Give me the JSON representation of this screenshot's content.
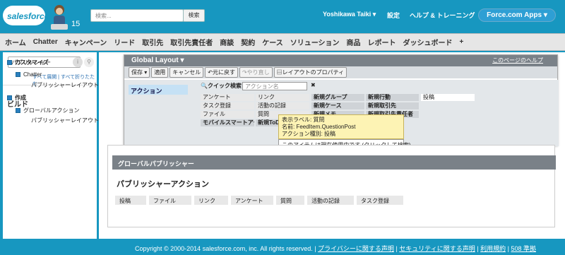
{
  "header": {
    "logo_text": "salesforce",
    "logo_number": "15",
    "search_placeholder": "検索...",
    "search_button": "検索",
    "user_name": "Yoshikawa Taiki ▾",
    "setup": "設定",
    "help": "ヘルプ & トレーニング",
    "apps": "Force.com Apps ▾"
  },
  "nav": {
    "tabs": [
      "ホーム",
      "Chatter",
      "キャンペーン",
      "リード",
      "取引先",
      "取引先責任者",
      "商談",
      "契約",
      "ケース",
      "ソリューション",
      "商品",
      "レポート",
      "ダッシュボード",
      "+"
    ]
  },
  "sidebar": {
    "search_value": "パブリッシャー",
    "expand_collapse": "すべて展開 | すべて折りたたむ",
    "section": "ビルド",
    "tree": [
      {
        "label": "カスタマイズ",
        "level": 0
      },
      {
        "label": "Chatter",
        "level": 1
      },
      {
        "label": "パブリッシャーレイアウト",
        "level": 2
      },
      {
        "label": "作成",
        "level": 0
      },
      {
        "label": "グローバルアクション",
        "level": 1
      },
      {
        "label": "パブリッシャーレイアウト",
        "level": 2
      }
    ]
  },
  "layout_editor": {
    "title": "Global Layout ▾",
    "help_link": "このページのヘルプ",
    "toolbar": {
      "save": "保存 ▾",
      "apply": "適用",
      "cancel": "キャンセル",
      "undo": "元に戻す",
      "redo": "やり直し",
      "properties": "レイアウトのプロパティ"
    },
    "left_item": "アクション",
    "quick_search": "クイック検索",
    "quick_search_placeholder": "アクション名",
    "grid": [
      [
        "アンケート",
        "リンク",
        "新規グループ",
        "新規行動",
        "投稿"
      ],
      [
        "タスク登録",
        "活動の記録",
        "新規ケース",
        "新規取引先",
        ""
      ],
      [
        "ファイル",
        "質問",
        "新規メモ",
        "新規取引先責任者",
        ""
      ],
      [
        "モバイルスマートアク",
        "新規ToDo",
        "",
        "",
        ""
      ]
    ],
    "tooltip": {
      "label": "表示ラベル: 質問",
      "name": "名前: FeedItem.QuestionPost",
      "type": "アクション種別: 投稿",
      "note": "このアイテムは現在使用中です (クリックして検索)"
    }
  },
  "global_publisher": {
    "header": "グローバルパブリッシャー",
    "title": "パブリッシャーアクション",
    "actions": [
      "投稿",
      "ファイル",
      "リンク",
      "アンケート",
      "質問",
      "活動の記録",
      "タスク登録"
    ]
  },
  "footer": {
    "copyright": "Copyright © 2000-2014 salesforce.com, inc. All rights reserved. |",
    "privacy": "プライバシーに関する声明",
    "security": "セキュリティに関する声明",
    "terms": "利用規約",
    "access": "508 準拠"
  }
}
